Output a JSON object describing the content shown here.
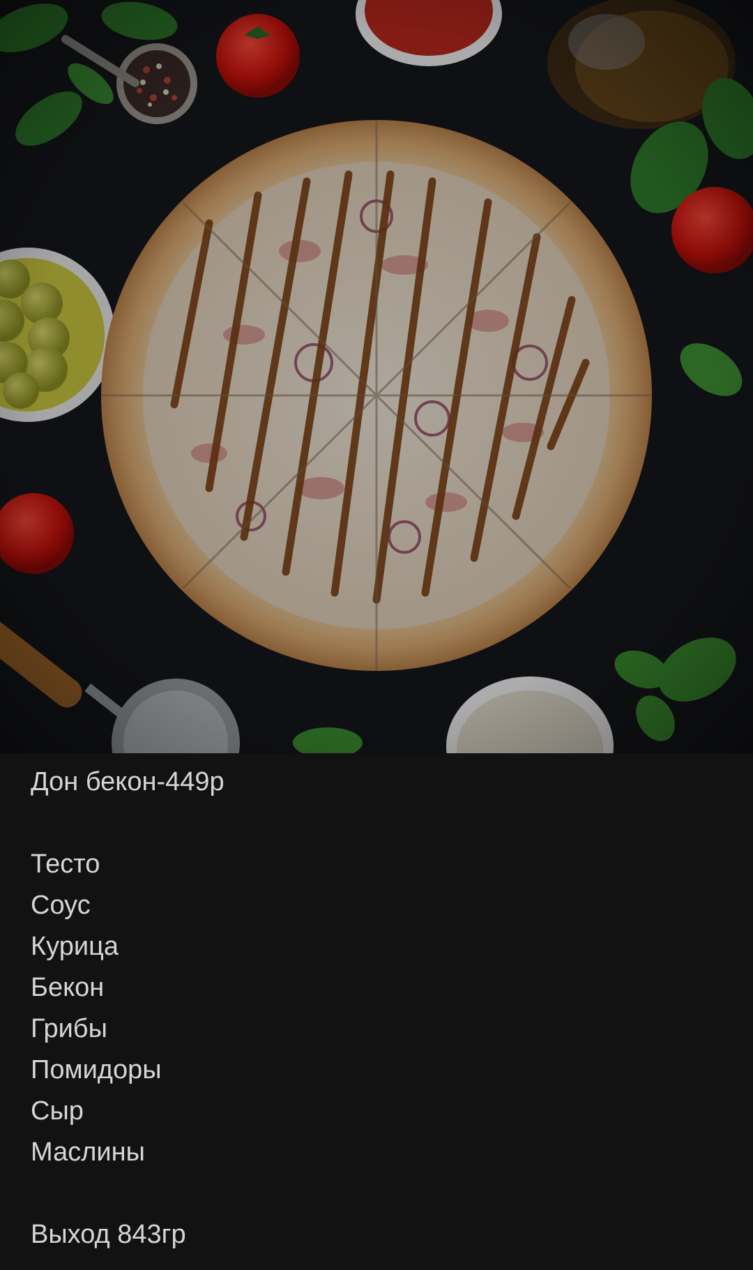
{
  "post": {
    "image_alt": "Pizza with bacon, chicken, onion and sauce on a dark table with tomatoes, olives, herbs and a pizza cutter",
    "title": "Дон бекон-449р",
    "ingredients": [
      "Тесто",
      "Соус",
      "Курица",
      "Бекон",
      "Грибы",
      "Помидоры",
      "Сыр",
      "Маслины"
    ],
    "weight": "Выход 843гр"
  },
  "colors": {
    "background": "#121212",
    "text": "#d6d6d6",
    "photo_background": "#0e0f12"
  }
}
